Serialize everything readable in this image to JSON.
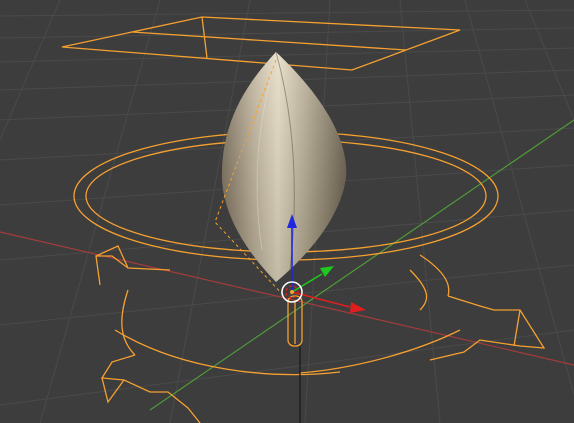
{
  "viewport": {
    "background": "#3d3d3d",
    "grid_color": "#4a4a4a",
    "x_axis_color": "#a33c3c",
    "y_axis_color": "#4f9a3a",
    "selection_color": "#f5a030"
  },
  "object": {
    "shape": "lathed teardrop mesh",
    "selected": true
  },
  "gizmo": {
    "x_arrow_color": "#e01e1e",
    "y_arrow_color": "#1ec81e",
    "z_arrow_color": "#1e28e0",
    "pivot_color": "#ffffff"
  },
  "rig_controls": [
    "overhead-rectangle",
    "root-circle-with-arrows",
    "ground-cross-arrows",
    "bone-capsule"
  ]
}
